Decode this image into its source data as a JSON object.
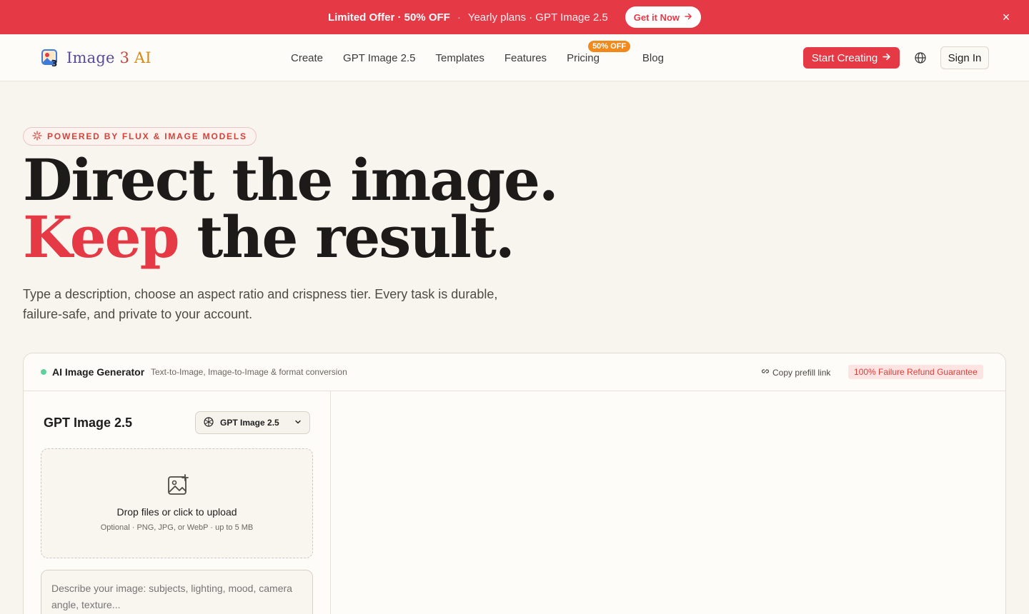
{
  "promo": {
    "headline": "Limited Offer · 50% OFF",
    "separator": "·",
    "subtitle": "Yearly plans · GPT Image 2.5",
    "button_label": "Get it Now",
    "close_symbol": "×"
  },
  "header": {
    "logo": {
      "part1": "Image ",
      "part2": "3 ",
      "part3": "AI"
    },
    "nav": [
      {
        "label": "Create"
      },
      {
        "label": "GPT Image 2.5"
      },
      {
        "label": "Templates"
      },
      {
        "label": "Features"
      },
      {
        "label": "Pricing",
        "badge": "50% OFF"
      },
      {
        "label": "Blog"
      }
    ],
    "start_button": "Start Creating",
    "signin_button": "Sign In"
  },
  "hero": {
    "pill": "POWERED BY FLUX & IMAGE MODELS",
    "title_line1": "Direct the image.",
    "title_accent": "Keep",
    "title_line2_rest": " the result.",
    "lead": "Type a description, choose an aspect ratio and crispness tier. Every task is durable, failure-safe, and private to your account."
  },
  "generator": {
    "title": "AI Image Generator",
    "subtitle": "Text-to-Image, Image-to-Image & format conversion",
    "copy_link": "Copy prefill link",
    "guarantee": "100% Failure Refund Guarantee",
    "model_title": "GPT Image 2.5",
    "model_select": "GPT Image 2.5",
    "upload_title": "Drop files or click to upload",
    "upload_sub": "Optional · PNG, JPG, or WebP · up to 5 MB",
    "prompt_placeholder": "Describe your image: subjects, lighting, mood, camera angle, texture..."
  },
  "colors": {
    "accent": "#e63946",
    "badge": "#f08a1c",
    "status": "#5fcf9c",
    "background": "#f8f5ef"
  }
}
